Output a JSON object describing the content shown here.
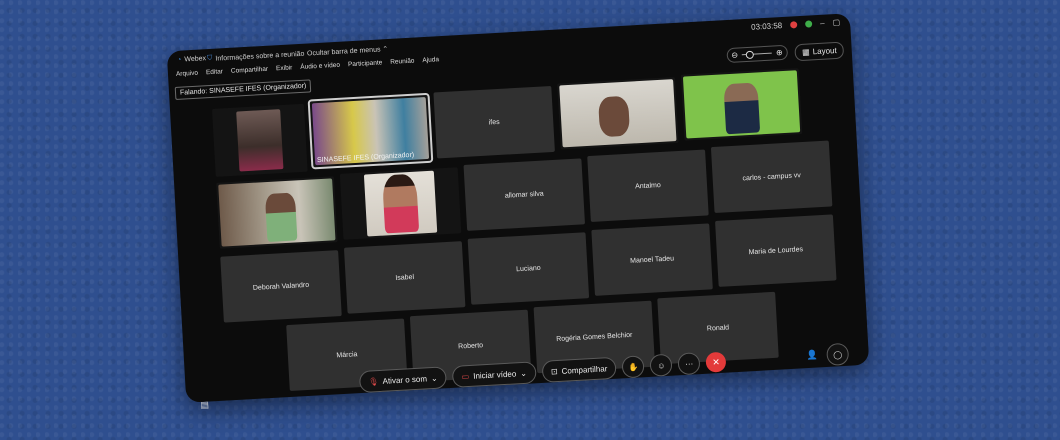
{
  "titlebar": {
    "app": "Webex",
    "info": "Informações sobre a reunião",
    "hide_menus": "Ocultar barra de menus",
    "timer": "03:03:58"
  },
  "menu": [
    "Arquivo",
    "Editar",
    "Compartilhar",
    "Exibir",
    "Áudio e vídeo",
    "Participante",
    "Reunião",
    "Ajuda"
  ],
  "speaking": "Falando: SINASEFE IFES (Organizador)",
  "layout_button": "Layout",
  "tiles": {
    "row1": [
      "",
      "SINASEFE IFES (Organizador)",
      "ifes",
      "",
      ""
    ],
    "row2": [
      "",
      "",
      "allomar silva",
      "Antalmo",
      "carlos - campus vv"
    ],
    "row3": [
      "Deborah Valandro",
      "Isabel",
      "Luciano",
      "Manoel Tadeu",
      "Maria de Lourdes"
    ],
    "row4": [
      "Márcia",
      "Roberto",
      "Rogéria Gomes Belchior",
      "Ronald"
    ]
  },
  "toolbar": {
    "mute": "Ativar o som",
    "video": "Iniciar vídeo",
    "share": "Compartilhar"
  },
  "colors": {
    "background": "#2f4f8f",
    "window": "#0c0c0c",
    "tile": "#303030",
    "end_call": "#e33a3a",
    "green_screen": "#7fc34b"
  }
}
